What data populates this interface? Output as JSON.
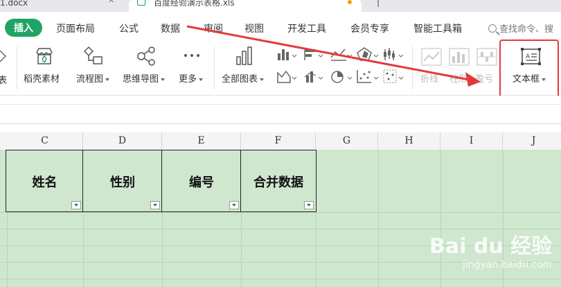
{
  "tabs": [
    {
      "label": "1.docx"
    },
    {
      "label": "百度经验演示表格.xls"
    }
  ],
  "menu": {
    "items": [
      "插入",
      "页面布局",
      "公式",
      "数据",
      "审阅",
      "视图",
      "开发工具",
      "会员专享",
      "智能工具箱"
    ],
    "active": "插入",
    "search_placeholder": "查找命令、搜"
  },
  "ribbon": {
    "left_cut": "表",
    "materials": "稻壳素材",
    "flowchart": "流程图",
    "mindmap": "思维导图",
    "more": "更多",
    "all_charts": "全部图表",
    "sparkline_line": "折线",
    "sparkline_column": "柱形",
    "sparkline_winloss": "盈亏",
    "textbox": "文本框"
  },
  "columns": [
    "C",
    "D",
    "E",
    "F",
    "G",
    "H",
    "I",
    "J"
  ],
  "headers": [
    "姓名",
    "性别",
    "编号",
    "合并数据"
  ],
  "watermark": {
    "brand": "Bai du 经验",
    "sub": "jingyan.baidu.com"
  },
  "colors": {
    "accent": "#21a366",
    "sheet_bg": "#cfe6cf",
    "annotation": "#e23a3a"
  }
}
